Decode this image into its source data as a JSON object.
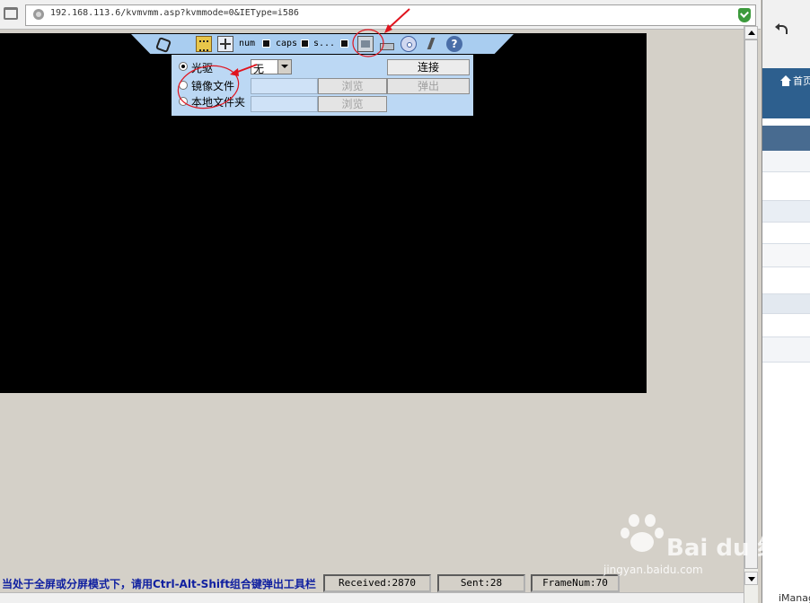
{
  "browser": {
    "url": "192.168.113.6/kvmvmm.asp?kvmmode=0&IEType=i586"
  },
  "toolbar": {
    "num_label": "num",
    "caps_label": "caps",
    "scroll_label": "s...",
    "help_glyph": "?"
  },
  "media_panel": {
    "options": [
      {
        "label": "光驱",
        "selected": true
      },
      {
        "label": "镜像文件",
        "selected": false
      },
      {
        "label": "本地文件夹",
        "selected": false
      }
    ],
    "drive_value": "无",
    "image_path": "",
    "folder_path": "",
    "browse_label": "浏览",
    "connect_label": "连接",
    "eject_label": "弹出"
  },
  "status": {
    "hint": "当处于全屏或分屏模式下，请用Ctrl-Alt-Shift组合键弹出工具栏",
    "received": "Received:2870",
    "sent": "Sent:28",
    "frame": "FrameNum:70"
  },
  "side_window": {
    "home_label": "首页",
    "bottom_text": "iManage"
  },
  "watermark": {
    "brand": "Bai du 经验",
    "url": "jingyan.baidu.com"
  },
  "colors": {
    "toolbar_bg": "#a9cdf0",
    "panel_bg": "#bcd8f4",
    "annotation_red": "#e0141e",
    "status_hint": "#1020a0",
    "side_nav": "#2d5f8e"
  }
}
